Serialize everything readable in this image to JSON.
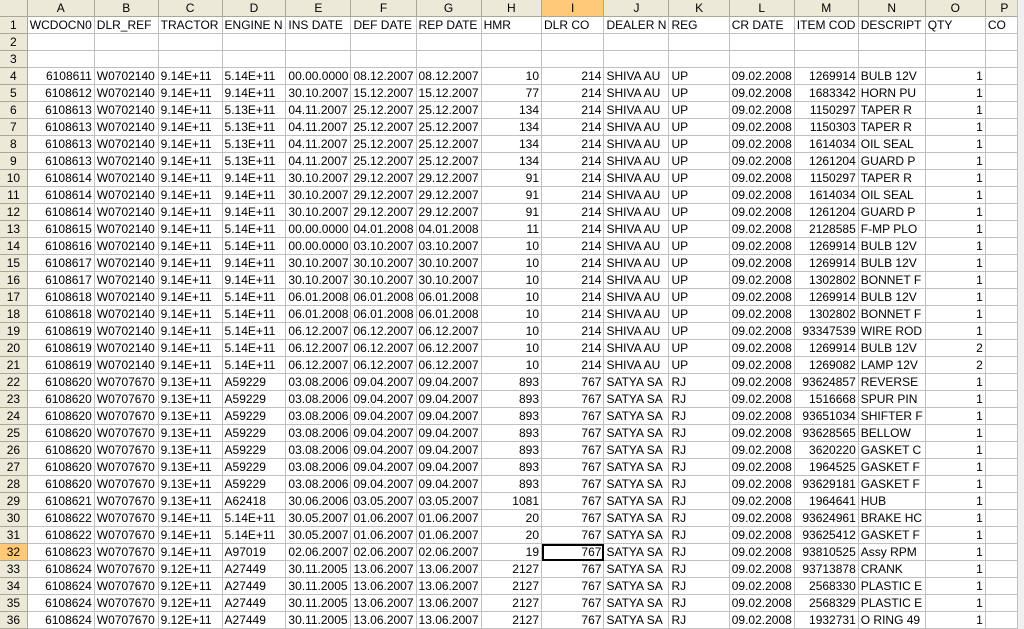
{
  "columns": [
    "A",
    "B",
    "C",
    "D",
    "E",
    "F",
    "G",
    "H",
    "I",
    "J",
    "K",
    "L",
    "M",
    "N",
    "O",
    "P"
  ],
  "selected_column": "I",
  "selected_row": "32",
  "rows": [
    {
      "n": "1",
      "cells": [
        "WCDOCN0",
        "DLR_REF",
        "TRACTOR",
        "ENGINE N",
        "INS DATE",
        "DEF DATE",
        "REP DATE",
        "HMR",
        "DLR CO",
        "DEALER N",
        "REG",
        "CR DATE",
        "ITEM COD",
        "DESCRIPT",
        "QTY",
        "CO"
      ]
    },
    {
      "n": "2",
      "cells": [
        "",
        "",
        "",
        "",
        "",
        "",
        "",
        "",
        "",
        "",
        "",
        "",
        "",
        "",
        "",
        ""
      ]
    },
    {
      "n": "3",
      "cells": [
        "",
        "",
        "",
        "",
        "",
        "",
        "",
        "",
        "",
        "",
        "",
        "",
        "",
        "",
        "",
        ""
      ]
    },
    {
      "n": "4",
      "cells": [
        "6108611",
        "W0702140",
        "9.14E+11",
        "5.14E+11",
        "00.00.0000",
        "08.12.2007",
        "08.12.2007",
        "10",
        "214",
        "SHIVA AU",
        "UP",
        "09.02.2008",
        "1269914",
        "BULB 12V",
        "1",
        ""
      ]
    },
    {
      "n": "5",
      "cells": [
        "6108612",
        "W0702140",
        "9.14E+11",
        "9.14E+11",
        "30.10.2007",
        "15.12.2007",
        "15.12.2007",
        "77",
        "214",
        "SHIVA AU",
        "UP",
        "09.02.2008",
        "1683342",
        "HORN PU",
        "1",
        ""
      ]
    },
    {
      "n": "6",
      "cells": [
        "6108613",
        "W0702140",
        "9.14E+11",
        "5.13E+11",
        "04.11.2007",
        "25.12.2007",
        "25.12.2007",
        "134",
        "214",
        "SHIVA AU",
        "UP",
        "09.02.2008",
        "1150297",
        "TAPER R",
        "1",
        ""
      ]
    },
    {
      "n": "7",
      "cells": [
        "6108613",
        "W0702140",
        "9.14E+11",
        "5.13E+11",
        "04.11.2007",
        "25.12.2007",
        "25.12.2007",
        "134",
        "214",
        "SHIVA AU",
        "UP",
        "09.02.2008",
        "1150303",
        "TAPER R",
        "1",
        ""
      ]
    },
    {
      "n": "8",
      "cells": [
        "6108613",
        "W0702140",
        "9.14E+11",
        "5.13E+11",
        "04.11.2007",
        "25.12.2007",
        "25.12.2007",
        "134",
        "214",
        "SHIVA AU",
        "UP",
        "09.02.2008",
        "1614034",
        "OIL SEAL",
        "1",
        ""
      ]
    },
    {
      "n": "9",
      "cells": [
        "6108613",
        "W0702140",
        "9.14E+11",
        "5.13E+11",
        "04.11.2007",
        "25.12.2007",
        "25.12.2007",
        "134",
        "214",
        "SHIVA AU",
        "UP",
        "09.02.2008",
        "1261204",
        "GUARD P",
        "1",
        ""
      ]
    },
    {
      "n": "10",
      "cells": [
        "6108614",
        "W0702140",
        "9.14E+11",
        "9.14E+11",
        "30.10.2007",
        "29.12.2007",
        "29.12.2007",
        "91",
        "214",
        "SHIVA AU",
        "UP",
        "09.02.2008",
        "1150297",
        "TAPER R",
        "1",
        ""
      ]
    },
    {
      "n": "11",
      "cells": [
        "6108614",
        "W0702140",
        "9.14E+11",
        "9.14E+11",
        "30.10.2007",
        "29.12.2007",
        "29.12.2007",
        "91",
        "214",
        "SHIVA AU",
        "UP",
        "09.02.2008",
        "1614034",
        "OIL SEAL",
        "1",
        ""
      ]
    },
    {
      "n": "12",
      "cells": [
        "6108614",
        "W0702140",
        "9.14E+11",
        "9.14E+11",
        "30.10.2007",
        "29.12.2007",
        "29.12.2007",
        "91",
        "214",
        "SHIVA AU",
        "UP",
        "09.02.2008",
        "1261204",
        "GUARD P",
        "1",
        ""
      ]
    },
    {
      "n": "13",
      "cells": [
        "6108615",
        "W0702140",
        "9.14E+11",
        "5.14E+11",
        "00.00.0000",
        "04.01.2008",
        "04.01.2008",
        "11",
        "214",
        "SHIVA AU",
        "UP",
        "09.02.2008",
        "2128585",
        "F-MP PLO",
        "1",
        ""
      ]
    },
    {
      "n": "14",
      "cells": [
        "6108616",
        "W0702140",
        "9.14E+11",
        "5.14E+11",
        "00.00.0000",
        "03.10.2007",
        "03.10.2007",
        "10",
        "214",
        "SHIVA AU",
        "UP",
        "09.02.2008",
        "1269914",
        "BULB 12V",
        "1",
        ""
      ]
    },
    {
      "n": "15",
      "cells": [
        "6108617",
        "W0702140",
        "9.14E+11",
        "9.14E+11",
        "30.10.2007",
        "30.10.2007",
        "30.10.2007",
        "10",
        "214",
        "SHIVA AU",
        "UP",
        "09.02.2008",
        "1269914",
        "BULB 12V",
        "1",
        ""
      ]
    },
    {
      "n": "16",
      "cells": [
        "6108617",
        "W0702140",
        "9.14E+11",
        "9.14E+11",
        "30.10.2007",
        "30.10.2007",
        "30.10.2007",
        "10",
        "214",
        "SHIVA AU",
        "UP",
        "09.02.2008",
        "1302802",
        "BONNET F",
        "1",
        ""
      ]
    },
    {
      "n": "17",
      "cells": [
        "6108618",
        "W0702140",
        "9.14E+11",
        "5.14E+11",
        "06.01.2008",
        "06.01.2008",
        "06.01.2008",
        "10",
        "214",
        "SHIVA AU",
        "UP",
        "09.02.2008",
        "1269914",
        "BULB 12V",
        "1",
        ""
      ]
    },
    {
      "n": "18",
      "cells": [
        "6108618",
        "W0702140",
        "9.14E+11",
        "5.14E+11",
        "06.01.2008",
        "06.01.2008",
        "06.01.2008",
        "10",
        "214",
        "SHIVA AU",
        "UP",
        "09.02.2008",
        "1302802",
        "BONNET F",
        "1",
        ""
      ]
    },
    {
      "n": "19",
      "cells": [
        "6108619",
        "W0702140",
        "9.14E+11",
        "5.14E+11",
        "06.12.2007",
        "06.12.2007",
        "06.12.2007",
        "10",
        "214",
        "SHIVA AU",
        "UP",
        "09.02.2008",
        "93347539",
        "WIRE ROD",
        "1",
        ""
      ]
    },
    {
      "n": "20",
      "cells": [
        "6108619",
        "W0702140",
        "9.14E+11",
        "5.14E+11",
        "06.12.2007",
        "06.12.2007",
        "06.12.2007",
        "10",
        "214",
        "SHIVA AU",
        "UP",
        "09.02.2008",
        "1269914",
        "BULB 12V",
        "2",
        ""
      ]
    },
    {
      "n": "21",
      "cells": [
        "6108619",
        "W0702140",
        "9.14E+11",
        "5.14E+11",
        "06.12.2007",
        "06.12.2007",
        "06.12.2007",
        "10",
        "214",
        "SHIVA AU",
        "UP",
        "09.02.2008",
        "1269082",
        "LAMP 12V",
        "2",
        ""
      ]
    },
    {
      "n": "22",
      "cells": [
        "6108620",
        "W0707670",
        "9.13E+11",
        "A59229",
        "03.08.2006",
        "09.04.2007",
        "09.04.2007",
        "893",
        "767",
        "SATYA SA",
        "RJ",
        "09.02.2008",
        "93624857",
        "REVERSE",
        "1",
        ""
      ]
    },
    {
      "n": "23",
      "cells": [
        "6108620",
        "W0707670",
        "9.13E+11",
        "A59229",
        "03.08.2006",
        "09.04.2007",
        "09.04.2007",
        "893",
        "767",
        "SATYA SA",
        "RJ",
        "09.02.2008",
        "1516668",
        "SPUR PIN",
        "1",
        ""
      ]
    },
    {
      "n": "24",
      "cells": [
        "6108620",
        "W0707670",
        "9.13E+11",
        "A59229",
        "03.08.2006",
        "09.04.2007",
        "09.04.2007",
        "893",
        "767",
        "SATYA SA",
        "RJ",
        "09.02.2008",
        "93651034",
        "SHIFTER F",
        "1",
        ""
      ]
    },
    {
      "n": "25",
      "cells": [
        "6108620",
        "W0707670",
        "9.13E+11",
        "A59229",
        "03.08.2006",
        "09.04.2007",
        "09.04.2007",
        "893",
        "767",
        "SATYA SA",
        "RJ",
        "09.02.2008",
        "93628565",
        "BELLOW",
        "1",
        ""
      ]
    },
    {
      "n": "26",
      "cells": [
        "6108620",
        "W0707670",
        "9.13E+11",
        "A59229",
        "03.08.2006",
        "09.04.2007",
        "09.04.2007",
        "893",
        "767",
        "SATYA SA",
        "RJ",
        "09.02.2008",
        "3620220",
        "GASKET C",
        "1",
        ""
      ]
    },
    {
      "n": "27",
      "cells": [
        "6108620",
        "W0707670",
        "9.13E+11",
        "A59229",
        "03.08.2006",
        "09.04.2007",
        "09.04.2007",
        "893",
        "767",
        "SATYA SA",
        "RJ",
        "09.02.2008",
        "1964525",
        "GASKET F",
        "1",
        ""
      ]
    },
    {
      "n": "28",
      "cells": [
        "6108620",
        "W0707670",
        "9.13E+11",
        "A59229",
        "03.08.2006",
        "09.04.2007",
        "09.04.2007",
        "893",
        "767",
        "SATYA SA",
        "RJ",
        "09.02.2008",
        "93629181",
        "GASKET F",
        "1",
        ""
      ]
    },
    {
      "n": "29",
      "cells": [
        "6108621",
        "W0707670",
        "9.13E+11",
        "A62418",
        "30.06.2006",
        "03.05.2007",
        "03.05.2007",
        "1081",
        "767",
        "SATYA SA",
        "RJ",
        "09.02.2008",
        "1964641",
        "HUB",
        "1",
        ""
      ]
    },
    {
      "n": "30",
      "cells": [
        "6108622",
        "W0707670",
        "9.14E+11",
        "5.14E+11",
        "30.05.2007",
        "01.06.2007",
        "01.06.2007",
        "20",
        "767",
        "SATYA SA",
        "RJ",
        "09.02.2008",
        "93624961",
        "BRAKE HC",
        "1",
        ""
      ]
    },
    {
      "n": "31",
      "cells": [
        "6108622",
        "W0707670",
        "9.14E+11",
        "5.14E+11",
        "30.05.2007",
        "01.06.2007",
        "01.06.2007",
        "20",
        "767",
        "SATYA SA",
        "RJ",
        "09.02.2008",
        "93625412",
        "GASKET F",
        "1",
        ""
      ]
    },
    {
      "n": "32",
      "cells": [
        "6108623",
        "W0707670",
        "9.14E+11",
        "A97019",
        "02.06.2007",
        "02.06.2007",
        "02.06.2007",
        "19",
        "767",
        "SATYA SA",
        "RJ",
        "09.02.2008",
        "93810525",
        "Assy RPM",
        "1",
        ""
      ]
    },
    {
      "n": "33",
      "cells": [
        "6108624",
        "W0707670",
        "9.12E+11",
        "A27449",
        "30.11.2005",
        "13.06.2007",
        "13.06.2007",
        "2127",
        "767",
        "SATYA SA",
        "RJ",
        "09.02.2008",
        "93713878",
        "CRANK",
        "1",
        ""
      ]
    },
    {
      "n": "34",
      "cells": [
        "6108624",
        "W0707670",
        "9.12E+11",
        "A27449",
        "30.11.2005",
        "13.06.2007",
        "13.06.2007",
        "2127",
        "767",
        "SATYA SA",
        "RJ",
        "09.02.2008",
        "2568330",
        "PLASTIC E",
        "1",
        ""
      ]
    },
    {
      "n": "35",
      "cells": [
        "6108624",
        "W0707670",
        "9.12E+11",
        "A27449",
        "30.11.2005",
        "13.06.2007",
        "13.06.2007",
        "2127",
        "767",
        "SATYA SA",
        "RJ",
        "09.02.2008",
        "2568329",
        "PLASTIC E",
        "1",
        ""
      ]
    },
    {
      "n": "36",
      "cells": [
        "6108624",
        "W0707670",
        "9.12E+11",
        "A27449",
        "30.11.2005",
        "13.06.2007",
        "13.06.2007",
        "2127",
        "767",
        "SATYA SA",
        "RJ",
        "09.02.2008",
        "1932731",
        "O RING 49",
        "1",
        ""
      ]
    }
  ]
}
